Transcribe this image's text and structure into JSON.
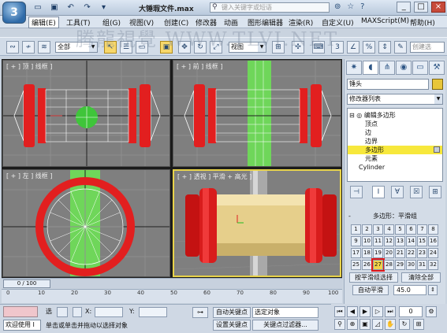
{
  "titlebar": {
    "doc_title": "大锤瑕文件.max",
    "search_placeholder": "键入关键字或短语",
    "logo_glyph": "3",
    "qa_icons": [
      "open-icon",
      "save-icon",
      "undo-icon",
      "redo-icon",
      "dropdown-icon"
    ],
    "right_icons": [
      "binoculars-icon",
      "star-icon",
      "help-icon"
    ],
    "window_controls": [
      "_",
      "□",
      "×"
    ]
  },
  "menu": {
    "items": [
      "编辑(E)",
      "工具(T)",
      "组(G)",
      "视图(V)",
      "创建(C)",
      "修改器",
      "动画",
      "图形编辑器",
      "渲染(R)",
      "自定义(U)",
      "MAXScript(M)",
      "帮助(H)"
    ]
  },
  "watermark": "腾龍視覺 WWW.TLVI.NET",
  "toolbar": {
    "selection_filter": "全部",
    "ref_coord": "视图",
    "named_set": "创建选"
  },
  "viewports": {
    "top_label": "[ + ] 顶 ] 线框 ]",
    "front_label": "[ + ] 前 ] 线框 ]",
    "left_label": "[ + ] 左 ] 线框 ]",
    "persp_label": "[ + ] 透视 ] 平滑 + 高光 ]"
  },
  "command_panel": {
    "object_name": "锤头",
    "modifier_list": "修改器列表",
    "stack": [
      {
        "label": "编辑多边形",
        "indent": 0
      },
      {
        "label": "顶点",
        "indent": 1
      },
      {
        "label": "边",
        "indent": 1
      },
      {
        "label": "边界",
        "indent": 1
      },
      {
        "label": "多边形",
        "indent": 1
      },
      {
        "label": "元素",
        "indent": 1
      },
      {
        "label": "Cylinder",
        "indent": 0
      }
    ],
    "selected_stack_item": "多边形",
    "smoothing_group_title": "多边形：平滑组",
    "smoothing_groups": [
      "1",
      "2",
      "3",
      "4",
      "5",
      "6",
      "7",
      "8",
      "9",
      "10",
      "11",
      "12",
      "13",
      "14",
      "15",
      "16",
      "17",
      "18",
      "19",
      "20",
      "21",
      "22",
      "23",
      "24",
      "25",
      "26",
      "27",
      "28",
      "29",
      "30",
      "31",
      "32"
    ],
    "highlighted_group": "27",
    "select_by_sg": "按平滑组选择",
    "clear_all": "清除全部",
    "auto_smooth": "自动平滑",
    "auto_smooth_value": "45.0"
  },
  "timeline": {
    "slider": "0 / 100",
    "ticks": [
      "0",
      "10",
      "20",
      "30",
      "40",
      "50",
      "60",
      "70",
      "80",
      "90",
      "100"
    ]
  },
  "status": {
    "welcome": "欢迎使用 I",
    "select_label": "选",
    "prompt": "单击或单击并拖动以选择对象",
    "x_label": "X:",
    "y_label": "Y:",
    "auto_key": "自动关键点",
    "set_key": "设置关键点",
    "selected_object": "选定对象",
    "key_filters": "关键点过滤器...",
    "frame": "0"
  }
}
